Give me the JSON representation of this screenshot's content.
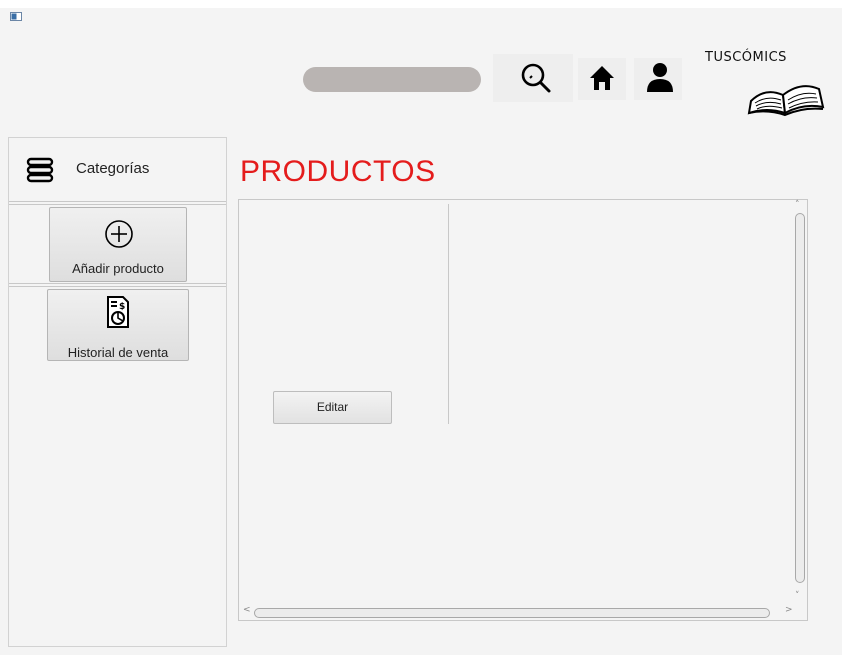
{
  "header": {
    "brand": "TUSCÓMICS",
    "search_value": ""
  },
  "sidebar": {
    "category_label": "Categorías",
    "add_product_label": "Añadir producto",
    "sales_history_label": "Historial de venta"
  },
  "main": {
    "title": "PRODUCTOS",
    "edit_label": "Editar"
  },
  "colors": {
    "title_red": "#e41c1c",
    "search_bar": "#b9b4b2",
    "background": "#f4f4f4"
  },
  "icons": {
    "window": "window-icon",
    "search": "magnifier-icon",
    "home": "home-icon",
    "user": "user-icon",
    "logo": "open-book-icon",
    "categories": "stack-menu-icon",
    "add": "plus-circle-icon",
    "history": "invoice-chart-icon"
  }
}
